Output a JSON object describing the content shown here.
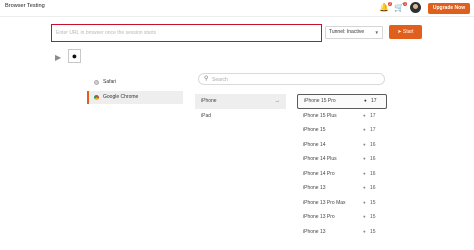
{
  "header": {
    "title": "Browser Testing",
    "notification_count": "2",
    "cart_count": "1",
    "upgrade_label": "Upgrade Now"
  },
  "session": {
    "url_placeholder": "Enter URL in browser once the session starts",
    "url_value": "",
    "tunnel_label": "Tunnel: Inactive",
    "start_label": "Start",
    "start_icon": "paper-plane-icon"
  },
  "os_tabs": [
    {
      "name": "android",
      "icon": "android-icon",
      "selected": false
    },
    {
      "name": "ios",
      "icon": "apple-icon",
      "selected": true
    }
  ],
  "browsers": [
    {
      "label": "Safari",
      "icon": "safari-icon",
      "selected": false
    },
    {
      "label": "Google Chrome",
      "icon": "chrome-icon",
      "selected": true
    }
  ],
  "search": {
    "placeholder": "Search",
    "value": ""
  },
  "device_types": [
    {
      "label": "iPhone",
      "selected": true
    },
    {
      "label": "iPad",
      "selected": false
    }
  ],
  "models": [
    {
      "name": "iPhone 15 Pro",
      "version": "17",
      "selected": true
    },
    {
      "name": "iPhone 15 Plus",
      "version": "17",
      "selected": false
    },
    {
      "name": "iPhone 15",
      "version": "17",
      "selected": false
    },
    {
      "name": "iPhone 14",
      "version": "16",
      "selected": false
    },
    {
      "name": "iPhone 14 Plus",
      "version": "16",
      "selected": false
    },
    {
      "name": "iPhone 14 Pro",
      "version": "16",
      "selected": false
    },
    {
      "name": "iPhone 13",
      "version": "16",
      "selected": false
    },
    {
      "name": "iPhone 13 Pro Max",
      "version": "15",
      "selected": false
    },
    {
      "name": "iPhone 13 Pro",
      "version": "15",
      "selected": false
    },
    {
      "name": "iPhone 13",
      "version": "15",
      "selected": false
    }
  ],
  "colors": {
    "accent": "#e05f1c",
    "url_border": "#c8102e",
    "selected_bg": "#eeeeee"
  }
}
